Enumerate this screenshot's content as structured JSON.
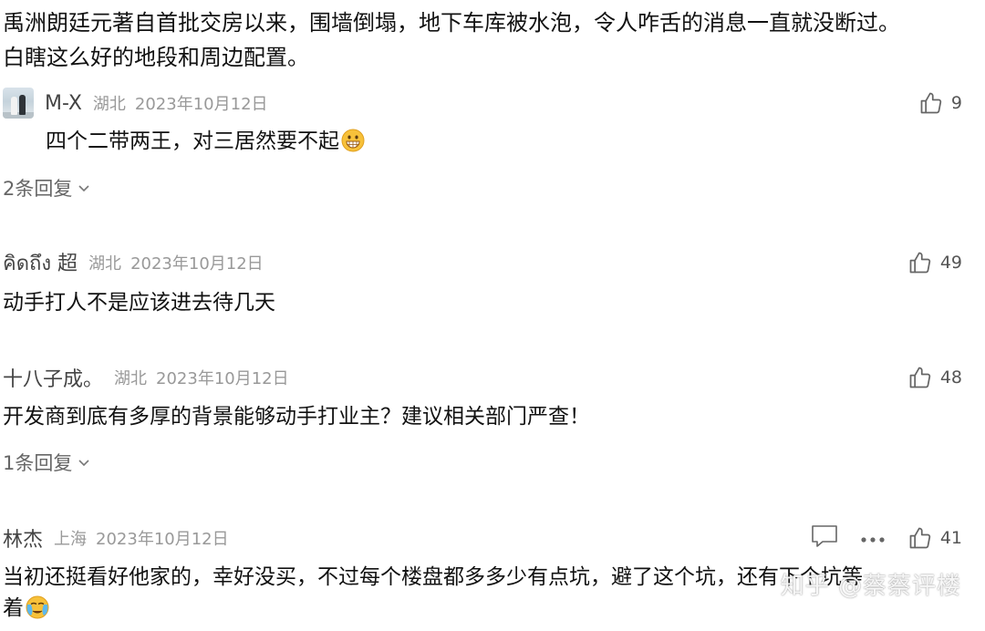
{
  "post": {
    "text_line1": "禹洲朗廷元著自首批交房以来，围墙倒塌，地下车库被水泡，令人咋舌的消息一直就没断过。",
    "text_line2": "白瞎这么好的地段和周边配置。"
  },
  "comments": [
    {
      "author": "M-X",
      "location": "湖北",
      "date": "2023年10月12日",
      "likes": "9",
      "text": "四个二带两王，对三居然要不起",
      "emoji": "grinning-face-icon",
      "replies": "2条回复"
    },
    {
      "author": "คิดถึง 超",
      "location": "湖北",
      "date": "2023年10月12日",
      "likes": "49",
      "text": "动手打人不是应该进去待几天"
    },
    {
      "author": "十八子成。",
      "location": "湖北",
      "date": "2023年10月12日",
      "likes": "48",
      "text": "开发商到底有多厚的背景能够动手打业主？建议相关部门严查！",
      "replies": "1条回复"
    },
    {
      "author": "林杰",
      "location": "上海",
      "date": "2023年10月12日",
      "likes": "41",
      "text_line1": "当初还挺看好他家的，幸好没买，不过每个楼盘都多多少有点坑，避了这个坑，还有下个坑等",
      "text_line2": "着",
      "emoji": "crying-face-icon"
    }
  ],
  "watermark": "知乎 @蔡蔡评楼",
  "colors": {
    "text": "#121212",
    "meta": "#999999",
    "icon": "#666666"
  }
}
